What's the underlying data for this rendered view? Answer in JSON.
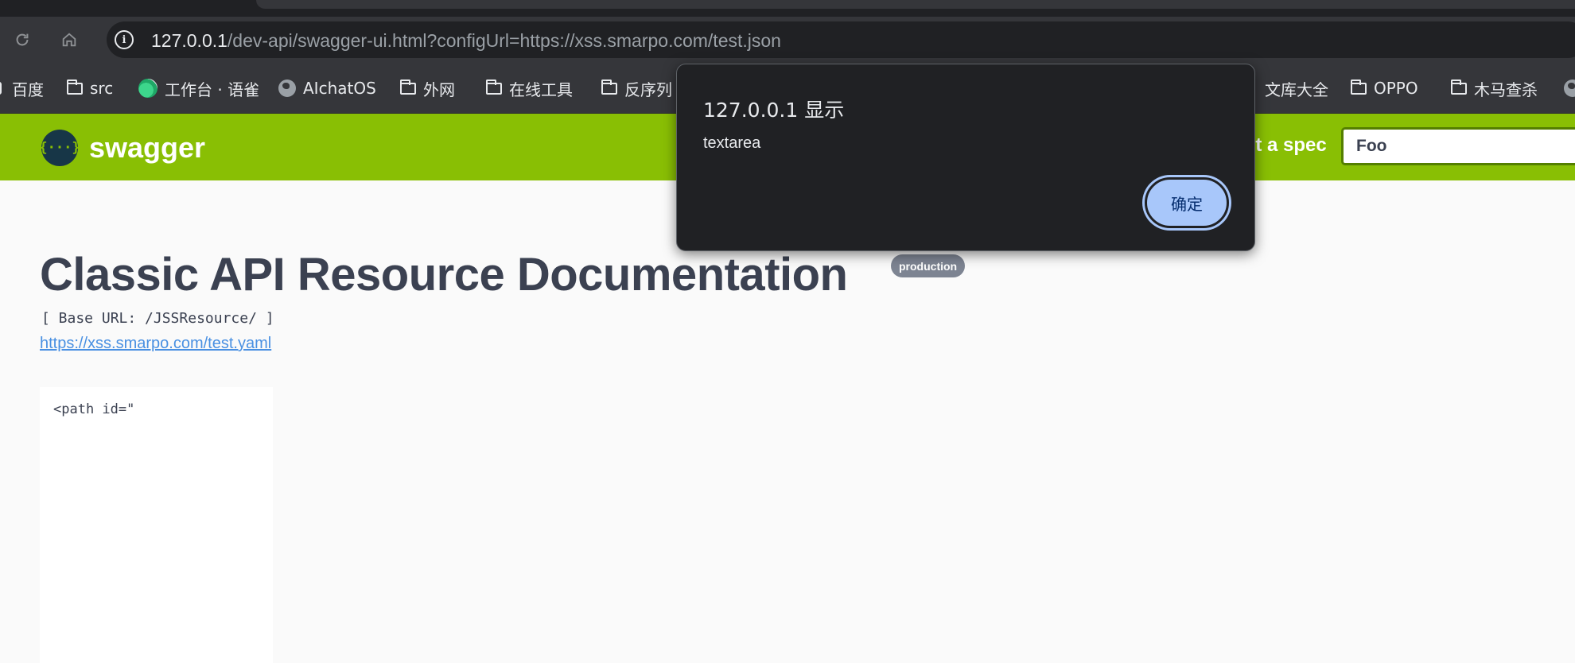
{
  "browser": {
    "url_host": "127.0.0.1",
    "url_path": "/dev-api/swagger-ui.html?configUrl=https://xss.smarpo.com/test.json",
    "bookmarks": [
      {
        "label": "百度",
        "icon": "baidu-icon"
      },
      {
        "label": "src",
        "icon": "folder-icon"
      },
      {
        "label": "工作台 · 语雀",
        "icon": "yuque-icon"
      },
      {
        "label": "AIchatOS",
        "icon": "globe-icon"
      },
      {
        "label": "外网",
        "icon": "folder-icon"
      },
      {
        "label": "在线工具",
        "icon": "folder-icon"
      },
      {
        "label": "反序列",
        "icon": "folder-icon"
      },
      {
        "label": "文库大全",
        "icon": "none"
      },
      {
        "label": "OPPO",
        "icon": "folder-icon"
      },
      {
        "label": "木马查杀",
        "icon": "folder-icon"
      }
    ]
  },
  "swagger": {
    "logo_text": "swagger",
    "spec_label": "ct a spec",
    "spec_selected": "Foo",
    "accent_color": "#89bf04"
  },
  "info": {
    "title": "Classic API Resource Documentation",
    "badge": "production",
    "base_url": "[ Base URL: /JSSResource/ ]",
    "spec_link": "https://xss.smarpo.com/test.yaml",
    "description_code": "<path id=\""
  },
  "dialog": {
    "title": "127.0.0.1 显示",
    "message": "textarea",
    "ok_label": "确定"
  }
}
